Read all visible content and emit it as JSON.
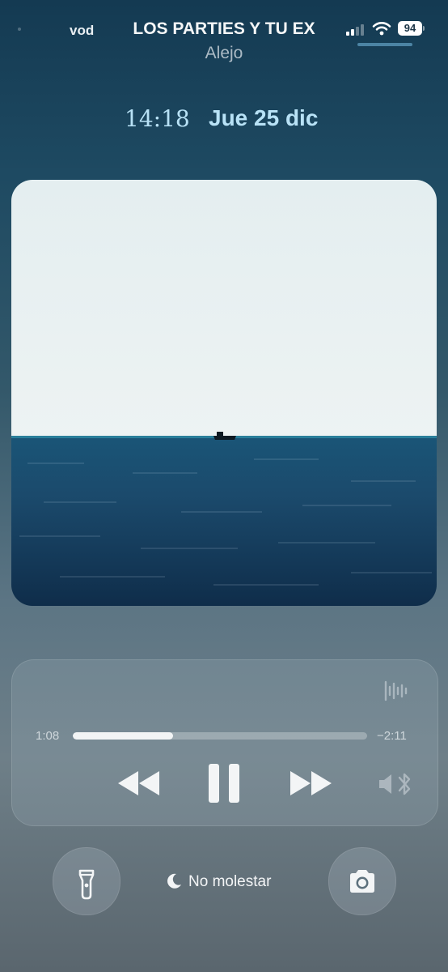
{
  "status_bar": {
    "carrier": "vod",
    "battery_level": "94",
    "icons": [
      "signal-icon",
      "wifi-icon",
      "battery-icon"
    ]
  },
  "lock_screen": {
    "time": "14:18",
    "date": "Jue 25 dic"
  },
  "now_playing": {
    "artwork": "ocean-horizon-with-boat",
    "title": "LOS PARTIES Y TU EX",
    "artist": "Alejo",
    "elapsed": "1:08",
    "remaining": "−2:11",
    "progress": 0.34,
    "controls": [
      "rewind-icon",
      "pause-icon",
      "fast-forward-icon",
      "bluetooth-speaker-icon"
    ]
  },
  "bottom_row": {
    "flashlight": "flashlight-icon",
    "focus_label": "No molestar",
    "focus_icon": "moon-icon",
    "camera": "camera-icon"
  },
  "colors": {
    "accent_text": "#b8e2f6",
    "progress_fill": "#f2f4f5"
  }
}
